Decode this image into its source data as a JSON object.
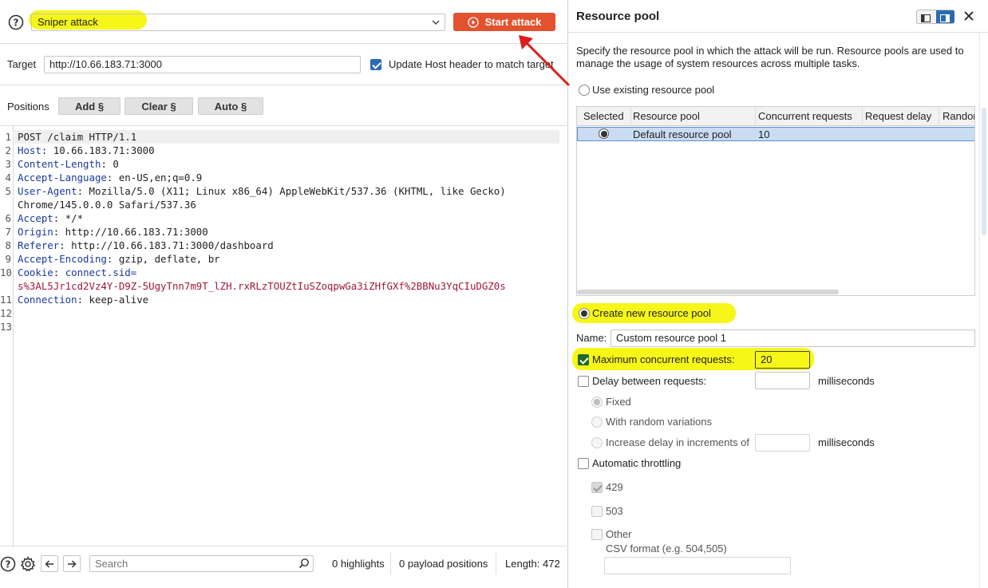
{
  "attack": {
    "type_value": "Sniper attack",
    "start_button_label": "Start attack"
  },
  "target": {
    "label": "Target",
    "value": "http://10.66.183.71:3000",
    "update_host_label": "Update Host header to match target"
  },
  "positions": {
    "label": "Positions",
    "add_label": "Add §",
    "clear_label": "Clear §",
    "auto_label": "Auto §"
  },
  "request_lines": [
    {
      "num": "1",
      "name": "POST /claim HTTP/1.1",
      "value": ""
    },
    {
      "num": "2",
      "name": "Host",
      "value": ": 10.66.183.71:3000"
    },
    {
      "num": "3",
      "name": "Content-Length",
      "value": ": 0"
    },
    {
      "num": "4",
      "name": "Accept-Language",
      "value": ": en-US,en;q=0.9"
    },
    {
      "num": "5",
      "name": "User-Agent",
      "value": ": Mozilla/5.0 (X11; Linux x86_64) AppleWebKit/537.36 (KHTML, like Gecko)"
    },
    {
      "num": "",
      "name": "",
      "value": "Chrome/145.0.0.0 Safari/537.36"
    },
    {
      "num": "6",
      "name": "Accept",
      "value": ": */*"
    },
    {
      "num": "7",
      "name": "Origin",
      "value": ": http://10.66.183.71:3000"
    },
    {
      "num": "8",
      "name": "Referer",
      "value": ": http://10.66.183.71:3000/dashboard"
    },
    {
      "num": "9",
      "name": "Accept-Encoding",
      "value": ": gzip, deflate, br"
    },
    {
      "num": "10",
      "name": "Cookie",
      "value": ": connect.sid="
    },
    {
      "num": "",
      "name": "",
      "value": "s%3AL5Jr1cd2Vz4Y-D9Z-5UgyTnn7m9T_lZH.rxRLzTOUZtIuSZoqpwGa3iZHfGXf%2BBNu3YqCIuDGZ0s"
    },
    {
      "num": "11",
      "name": "Connection",
      "value": ": keep-alive"
    },
    {
      "num": "12",
      "name": "",
      "value": ""
    },
    {
      "num": "13",
      "name": "",
      "value": ""
    }
  ],
  "footer": {
    "search_placeholder": "Search",
    "highlights": "0 highlights",
    "payload_positions": "0 payload positions",
    "length": "Length: 472"
  },
  "resource_pool": {
    "title": "Resource pool",
    "description": "Specify the resource pool in which the attack will be run. Resource pools are used to manage the usage of system resources across multiple tasks.",
    "use_existing_label": "Use existing resource pool",
    "table": {
      "headers": [
        "Selected",
        "Resource pool",
        "Concurrent requests",
        "Request delay",
        "Random"
      ],
      "rows": [
        {
          "pool": "Default resource pool",
          "concurrent": "10",
          "delay": "",
          "random": ""
        }
      ]
    },
    "create_new_label": "Create new resource pool",
    "name_label": "Name:",
    "name_value": "Custom resource pool 1",
    "max_concurrent_label": "Maximum concurrent requests:",
    "max_concurrent_value": "20",
    "delay_label": "Delay between requests:",
    "milliseconds": "milliseconds",
    "fixed_label": "Fixed",
    "random_variations_label": "With random variations",
    "increase_delay_label": "Increase delay in increments of",
    "auto_throttling_label": "Automatic throttling",
    "code_429": "429",
    "code_503": "503",
    "other_label": "Other",
    "csv_label": "CSV format (e.g. 504,505)"
  },
  "colors": {
    "accent": "#e2522f",
    "highlight": "#f5f500",
    "selected_row": "#c9dcf2",
    "arrow": "#dd1c1c"
  }
}
